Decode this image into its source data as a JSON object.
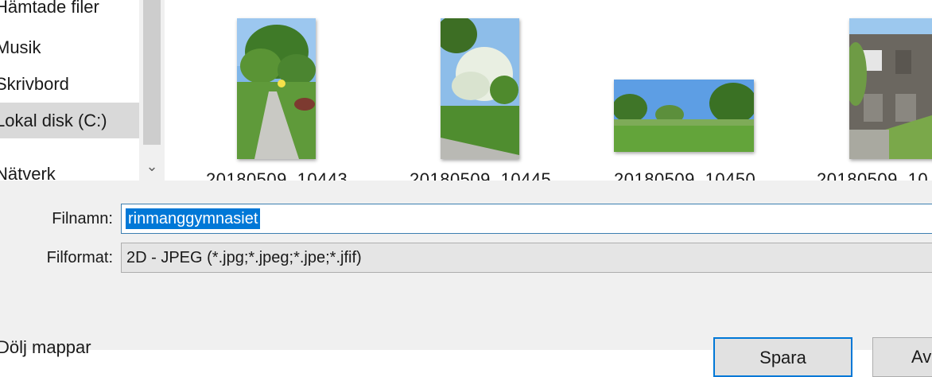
{
  "nav": {
    "items": [
      {
        "label": "Hämtade filer",
        "selected": false
      },
      {
        "label": "Musik",
        "selected": false
      },
      {
        "label": "Skrivbord",
        "selected": false
      },
      {
        "label": "Lokal disk (C:)",
        "selected": true
      },
      {
        "label": "Nätverk",
        "selected": false
      }
    ],
    "scroll_down_icon": "chevron-down-icon"
  },
  "files": [
    {
      "name": "20180509_10443"
    },
    {
      "name": "20180509_10445"
    },
    {
      "name": "20180509_10450"
    },
    {
      "name": "20180509_10"
    }
  ],
  "form": {
    "filename_label": "Filnamn:",
    "filename_value": "rinmanggymnasiet",
    "format_label": "Filformat:",
    "format_value": "2D - JPEG (*.jpg;*.jpeg;*.jpe;*.jfif)"
  },
  "footer": {
    "folders_toggle": "Dölj mappar",
    "save_button": "Spara",
    "cancel_button": "Avbryt"
  },
  "colors": {
    "selection": "#0078d7",
    "nav_selected": "#d9d9d9",
    "panel_bg": "#f0f0f0"
  }
}
